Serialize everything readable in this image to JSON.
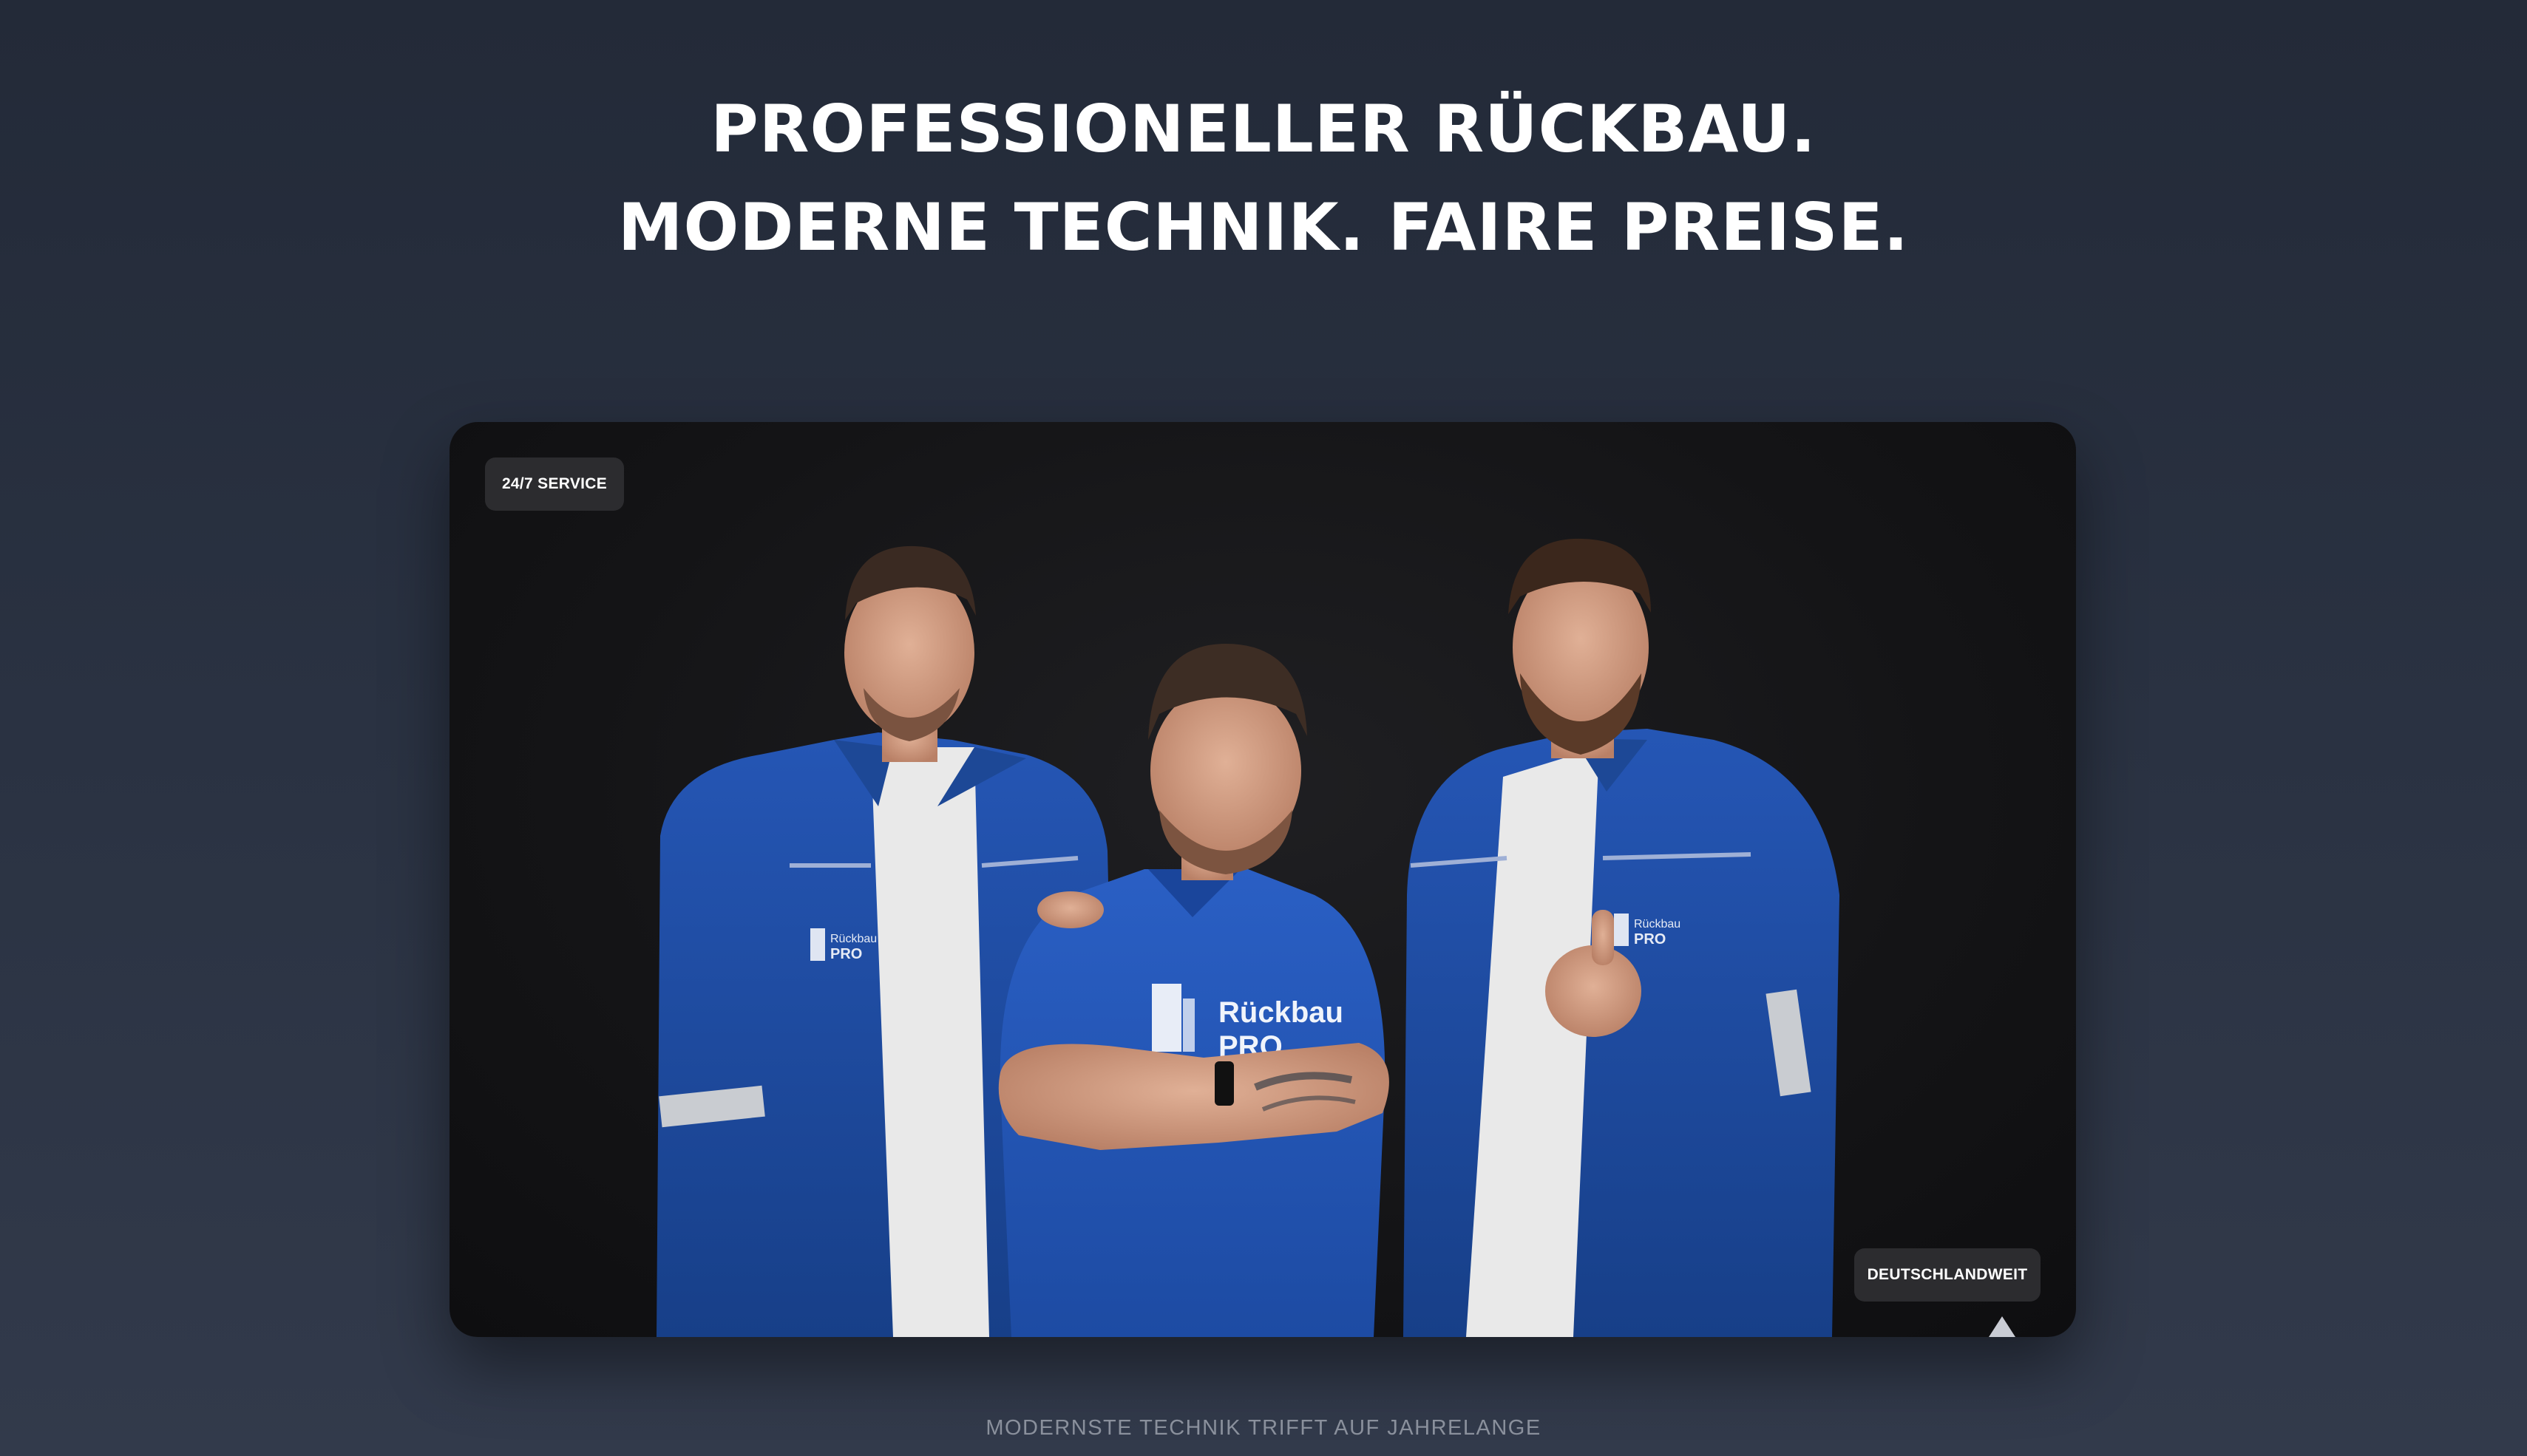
{
  "hero": {
    "line1": "PROFESSIONELLER RÜCKBAU.",
    "line2": "MODERNE TECHNIK. FAIRE PREISE."
  },
  "photo": {
    "badge_service": "24/7 SERVICE",
    "badge_region": "DEUTSCHLANDWEIT",
    "shirt_logo_line1": "Rückbau",
    "shirt_logo_line2": "PRO",
    "jacket_logo_line1": "Rückbau",
    "jacket_logo_line2": "PRO"
  },
  "tagline": "MODERNSTE TECHNIK TRIFFT AUF JAHRELANGE",
  "colors": {
    "background_top": "#232a38",
    "background_bottom": "#323a4b",
    "card_background": "#141416",
    "uniform_blue": "#1e4fa8",
    "badge_background": "#2c2c2f"
  }
}
